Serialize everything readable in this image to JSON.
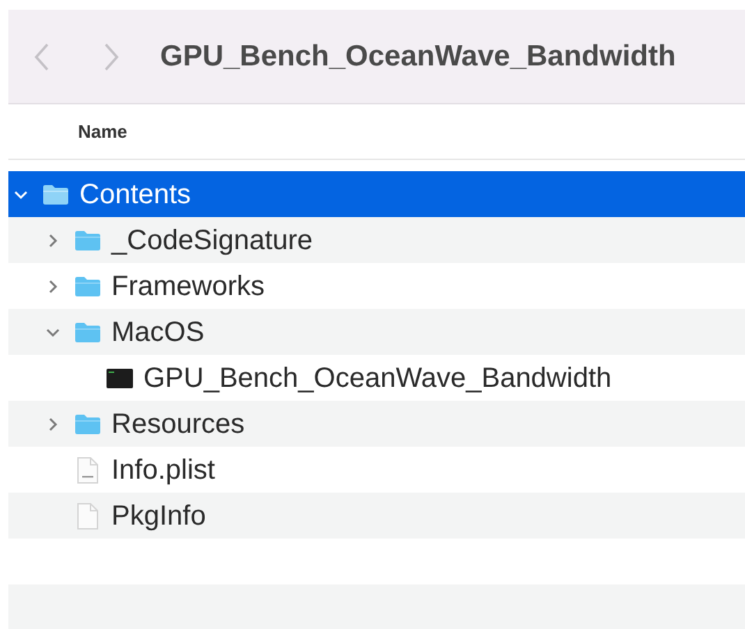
{
  "window": {
    "title": "GPU_Bench_OceanWave_Bandwidth"
  },
  "navigation": {
    "back_disabled": true,
    "forward_disabled": true
  },
  "table": {
    "columns": [
      "Name"
    ],
    "rows": [
      {
        "name": "Contents",
        "kind": "folder",
        "expanded": true,
        "selected": true,
        "children": [
          {
            "name": "_CodeSignature",
            "kind": "folder",
            "expanded": false,
            "selected": false
          },
          {
            "name": "Frameworks",
            "kind": "folder",
            "expanded": false,
            "selected": false
          },
          {
            "name": "MacOS",
            "kind": "folder",
            "expanded": true,
            "selected": false,
            "children": [
              {
                "name": "GPU_Bench_OceanWave_Bandwidth",
                "kind": "executable",
                "selected": false
              }
            ]
          },
          {
            "name": "Resources",
            "kind": "folder",
            "expanded": false,
            "selected": false
          },
          {
            "name": "Info.plist",
            "kind": "plist",
            "selected": false
          },
          {
            "name": "PkgInfo",
            "kind": "file",
            "selected": false
          }
        ]
      }
    ]
  }
}
